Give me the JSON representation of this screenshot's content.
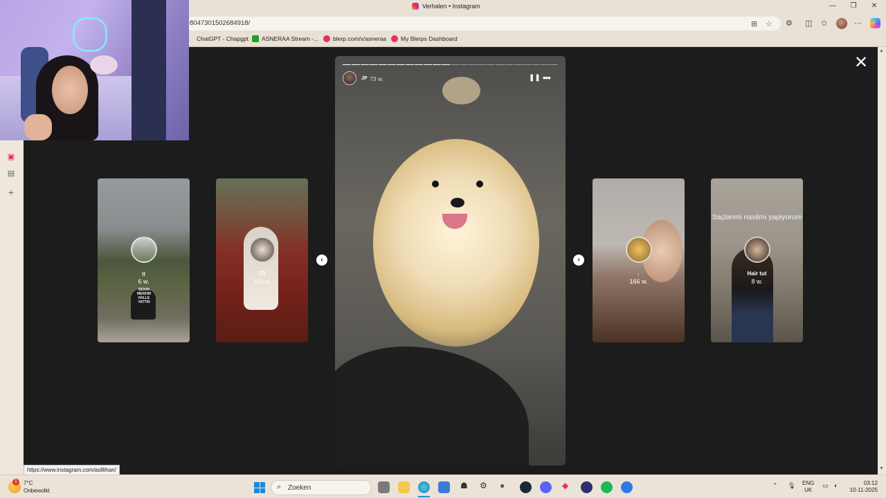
{
  "browser": {
    "tab_title": "Verhalen • Instagram",
    "url": "8047301502684918/",
    "window_controls": [
      "—",
      "❐",
      "✕"
    ],
    "bookmarks": [
      {
        "label": "ChatGPT - Chapgpt",
        "color": "#e9e1d6"
      },
      {
        "label": "ASNERAA Stream -...",
        "color": "#1fa31f"
      },
      {
        "label": "blerp.com/x/asneraa",
        "color": "#e8305c"
      },
      {
        "label": "My Blerps Dashboard",
        "color": "#e8305c"
      }
    ],
    "status_url": "https://www.instagram.com/aslllihan/"
  },
  "viewer": {
    "close_icon": "✕",
    "prev_icon": "‹",
    "next_icon": "›",
    "thumbnails": [
      {
        "user": "ᴉᴉ",
        "age": "6 w.",
        "overlay_text": "BENIM MERDIM HALLE YATTIN"
      },
      {
        "user": "TR",
        "age": "163 w."
      },
      {
        "user": ".",
        "age": "166 w."
      },
      {
        "user": "Hair tut",
        "age": "8 w.",
        "caption": "Saçlarimi nasilmi yapiyorum"
      }
    ],
    "story": {
      "user": "JP",
      "age": "73 w.",
      "pause_icon": "❚❚",
      "more_icon": "•••",
      "progress_segments": 24,
      "progress_done": 12
    }
  },
  "taskbar": {
    "weather_temp": "7°C",
    "weather_condition": "Onbewolkt",
    "weather_badge": "1",
    "search_label": "Zoeken",
    "lang_top": "ENG",
    "lang_bottom": "UK",
    "time": "03:12",
    "date": "10-11-2025"
  },
  "colors": {
    "viewer_bg": "#1c1c1c",
    "chrome_bg": "#e9e1d6",
    "accent_blue": "#1a8ad8"
  }
}
